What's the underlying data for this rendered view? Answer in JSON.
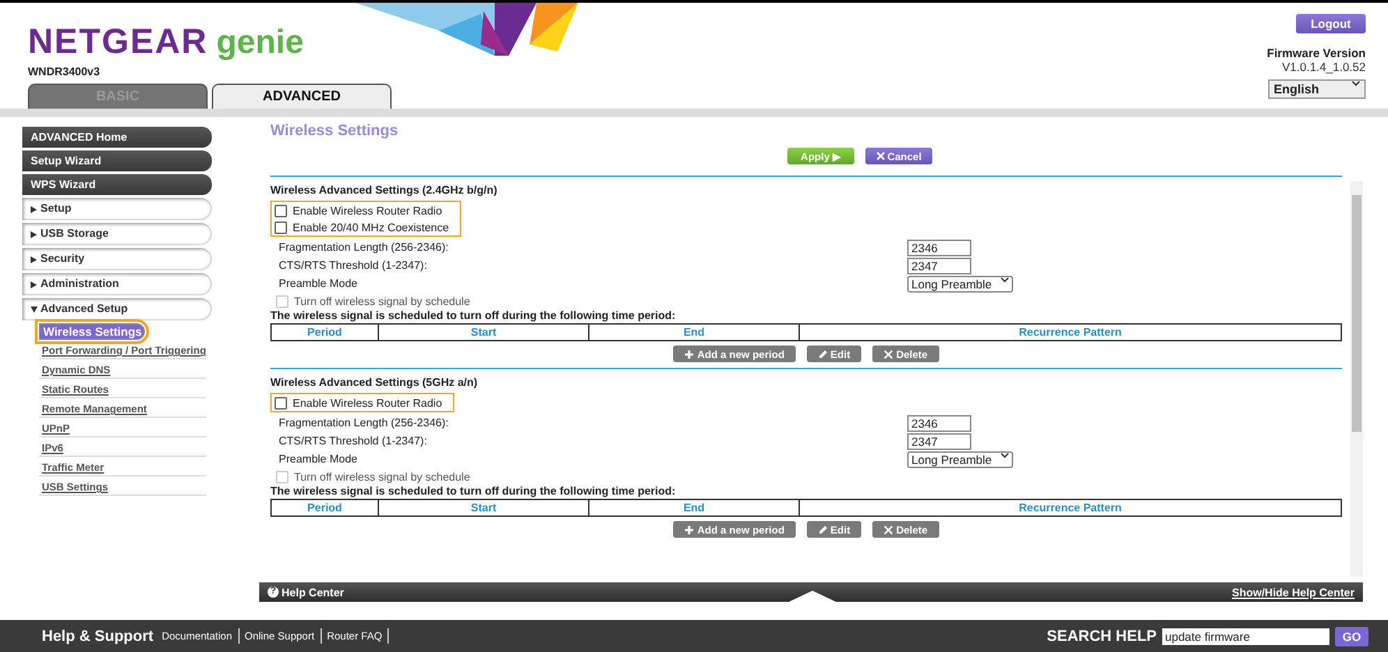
{
  "header": {
    "brand": "NETGEAR",
    "brand_suffix": "genie",
    "model": "WNDR3400v3",
    "tabs": [
      {
        "label": "BASIC",
        "selected": false
      },
      {
        "label": "ADVANCED",
        "selected": true
      }
    ],
    "logout": "Logout",
    "firmware_label": "Firmware Version",
    "firmware_version": "V1.0.1.4_1.0.52",
    "language": "English"
  },
  "sidebar": {
    "items": [
      {
        "label": "ADVANCED Home",
        "kind": "top"
      },
      {
        "label": "Setup Wizard",
        "kind": "top"
      },
      {
        "label": "WPS Wizard",
        "kind": "top"
      },
      {
        "label": "Setup",
        "kind": "section",
        "expanded": false
      },
      {
        "label": "USB Storage",
        "kind": "section",
        "expanded": false
      },
      {
        "label": "Security",
        "kind": "section",
        "expanded": false
      },
      {
        "label": "Administration",
        "kind": "section",
        "expanded": false
      },
      {
        "label": "Advanced Setup",
        "kind": "section",
        "expanded": true
      },
      {
        "label": "Wireless Settings",
        "kind": "link",
        "selected": true
      },
      {
        "label": "Port Forwarding / Port Triggering",
        "kind": "link",
        "selected": false
      },
      {
        "label": "Dynamic DNS",
        "kind": "link",
        "selected": false
      },
      {
        "label": "Static Routes",
        "kind": "link",
        "selected": false
      },
      {
        "label": "Remote Management",
        "kind": "link",
        "selected": false
      },
      {
        "label": "UPnP",
        "kind": "link",
        "selected": false
      },
      {
        "label": "IPv6",
        "kind": "link",
        "selected": false
      },
      {
        "label": "Traffic Meter",
        "kind": "link",
        "selected": false
      },
      {
        "label": "USB Settings",
        "kind": "link",
        "selected": false
      }
    ]
  },
  "page": {
    "title": "Wireless Settings",
    "apply": "Apply ▶",
    "cancel": "Cancel",
    "sections": [
      {
        "title": "Wireless Advanced Settings (2.4GHz b/g/n)",
        "checkboxes": [
          {
            "label": "Enable Wireless Router Radio",
            "checked": false,
            "highlighted": true
          },
          {
            "label": "Enable 20/40 MHz Coexistence",
            "checked": false,
            "highlighted": true
          }
        ],
        "fields": [
          {
            "label": "Fragmentation Length (256-2346):",
            "value": "2346",
            "kind": "input"
          },
          {
            "label": "CTS/RTS Threshold (1-2347):",
            "value": "2347",
            "kind": "input"
          },
          {
            "label": "Preamble Mode",
            "value": "Long Preamble",
            "kind": "select"
          }
        ],
        "schedule": {
          "label": "Turn off wireless signal by schedule",
          "checked": false,
          "disabled": true
        },
        "schedule_note": "The wireless signal is scheduled to turn off during the following time period:",
        "columns": [
          "Period",
          "Start",
          "End",
          "Recurrence Pattern"
        ],
        "buttons": [
          {
            "label": "Add a new period",
            "kind": "add"
          },
          {
            "label": "Edit",
            "kind": "edit"
          },
          {
            "label": "Delete",
            "kind": "delete"
          }
        ]
      },
      {
        "title": "Wireless Advanced Settings (5GHz a/n)",
        "checkboxes": [
          {
            "label": "Enable Wireless Router Radio",
            "checked": false,
            "highlighted": true
          }
        ],
        "fields": [
          {
            "label": "Fragmentation Length (256-2346):",
            "value": "2346",
            "kind": "input"
          },
          {
            "label": "CTS/RTS Threshold (1-2347):",
            "value": "2347",
            "kind": "input"
          },
          {
            "label": "Preamble Mode",
            "value": "Long Preamble",
            "kind": "select"
          }
        ],
        "schedule": {
          "label": "Turn off wireless signal by schedule",
          "checked": false,
          "disabled": true
        },
        "schedule_note": "The wireless signal is scheduled to turn off during the following time period:",
        "columns": [
          "Period",
          "Start",
          "End",
          "Recurrence Pattern"
        ],
        "buttons": [
          {
            "label": "Add a new period",
            "kind": "add"
          },
          {
            "label": "Edit",
            "kind": "edit"
          },
          {
            "label": "Delete",
            "kind": "delete"
          }
        ]
      }
    ]
  },
  "help_bar": {
    "icon": "?",
    "title": "Help Center",
    "toggle": "Show/Hide Help Center"
  },
  "footer": {
    "title": "Help & Support",
    "links": [
      "Documentation",
      "Online Support",
      "Router FAQ"
    ],
    "search_label": "SEARCH HELP",
    "search_value": "update firmware",
    "go": "GO"
  }
}
